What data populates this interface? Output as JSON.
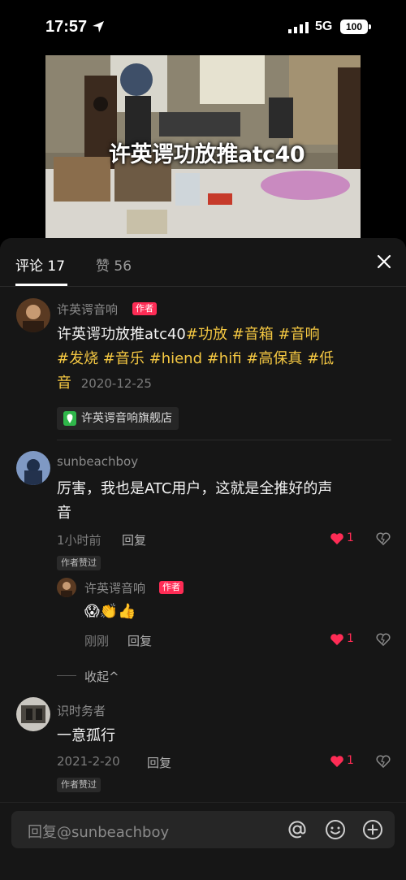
{
  "status_bar": {
    "time": "17:57",
    "network": "5G",
    "battery": "100"
  },
  "video": {
    "caption": "许英谔功放推atc40"
  },
  "tabs": {
    "comments_label": "评论 17",
    "likes_label": "赞 56"
  },
  "post": {
    "username": "许英谔音响",
    "badge": "作者",
    "text_plain": "许英谔功放推atc40",
    "tags_line1": "#功放 #音箱 #音响",
    "tags_line2": "#发烧 #音乐 #hiend #hifi #高保真 #低",
    "tags_line3": "音",
    "date": "2020-12-25",
    "location": "许英谔音响旗舰店"
  },
  "comments": [
    {
      "username": "sunbeachboy",
      "text_line1": "厉害，我也是ATC用户，这就是全推好的声",
      "text_line2": "音",
      "time": "1小时前",
      "reply_label": "回复",
      "likes": "1",
      "liked_badge": "作者赞过",
      "reply": {
        "username": "许英谔音响",
        "badge": "作者",
        "emojis": "😱👏👍",
        "time": "刚刚",
        "reply_label": "回复",
        "likes": "1"
      },
      "collapse_label": "收起^"
    },
    {
      "username": "识时务者",
      "text": "一意孤行",
      "time": "2021-2-20",
      "reply_label": "回复",
      "likes": "1",
      "liked_badge": "作者赞过"
    }
  ],
  "input": {
    "placeholder": "回复@sunbeachboy"
  },
  "icons": {
    "at": "at-icon",
    "emoji": "emoji-icon",
    "add": "add-icon",
    "close": "close-icon",
    "heart": "heart-icon",
    "dislike": "dislike-icon"
  },
  "colors": {
    "accent": "#fe2c55",
    "tag": "#f5c842",
    "panel": "#161616"
  }
}
